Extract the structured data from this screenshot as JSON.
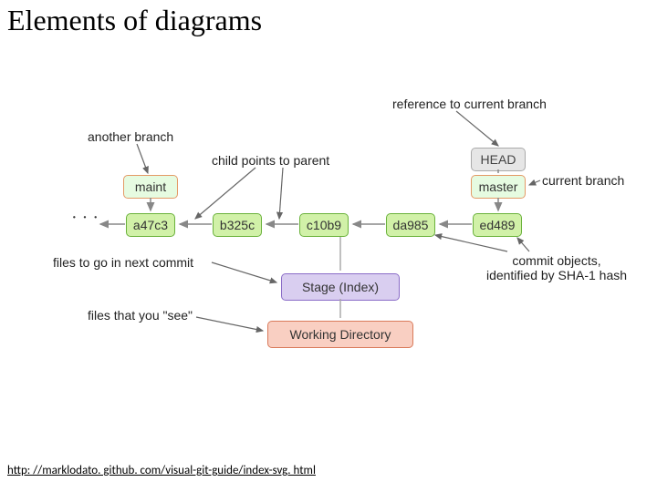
{
  "title": "Elements of diagrams",
  "labels": {
    "ref_current": "reference to current branch",
    "another_branch": "another branch",
    "child_parent": "child points to parent",
    "current_branch": "current branch",
    "files_next_commit": "files to go in next commit",
    "files_you_see": "files that you \"see\"",
    "commit_objects": "commit objects,",
    "commit_objects2": "identified by SHA-1 hash"
  },
  "boxes": {
    "maint": "maint",
    "head": "HEAD",
    "master": "master",
    "stage": "Stage (Index)",
    "wd": "Working Directory"
  },
  "commits": [
    "a47c3",
    "b325c",
    "c10b9",
    "da985",
    "ed489"
  ],
  "dots": "· · ·",
  "footer_link": "http: //marklodato. github. com/visual-git-guide/index-svg. html"
}
